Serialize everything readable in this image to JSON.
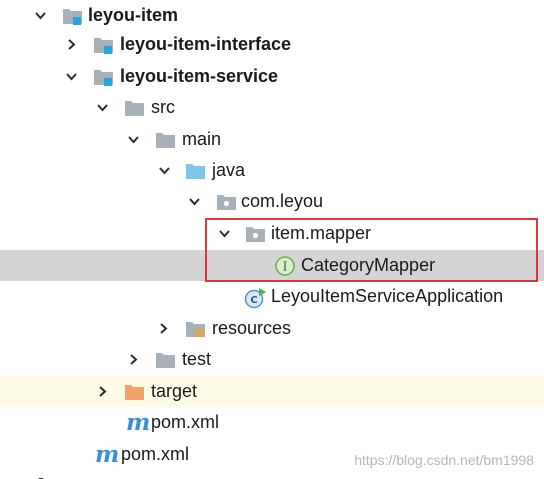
{
  "project_tree": {
    "nodes": [
      {
        "label": "leyou-item",
        "icon": "module-folder-icon",
        "expanded": true
      },
      {
        "label": "leyou-item-interface",
        "icon": "module-folder-icon",
        "expanded": false
      },
      {
        "label": "leyou-item-service",
        "icon": "module-folder-icon",
        "expanded": true
      },
      {
        "label": "src",
        "icon": "folder-icon",
        "expanded": true
      },
      {
        "label": "main",
        "icon": "folder-icon",
        "expanded": true
      },
      {
        "label": "java",
        "icon": "source-root-folder-icon",
        "expanded": true
      },
      {
        "label": "com.leyou",
        "icon": "package-icon",
        "expanded": true
      },
      {
        "label": "item.mapper",
        "icon": "package-icon",
        "expanded": true
      },
      {
        "label": "CategoryMapper",
        "icon": "interface-icon",
        "selected": true
      },
      {
        "label": "LeyouItemServiceApplication",
        "icon": "spring-boot-class-icon"
      },
      {
        "label": "resources",
        "icon": "resources-folder-icon",
        "expanded": false
      },
      {
        "label": "test",
        "icon": "folder-icon",
        "expanded": false
      },
      {
        "label": "target",
        "icon": "excluded-folder-icon",
        "expanded": false
      },
      {
        "label": "pom.xml",
        "icon": "maven-icon"
      },
      {
        "label": "pom.xml",
        "icon": "maven-icon"
      }
    ],
    "maven_glyph": "m",
    "interface_glyph": "I"
  },
  "colors": {
    "selection_bg": "#d4d4d4",
    "excluded_bg": "#fdfbe6",
    "highlight_border": "#e0353b",
    "module_marker": "#2aa5e0",
    "folder": "#a9b1b8",
    "source_folder": "#7ec7ea",
    "excluded_folder": "#f4a26b",
    "interface_icon": "#6fb050"
  },
  "watermark": "https://blog.csdn.net/bm1998"
}
